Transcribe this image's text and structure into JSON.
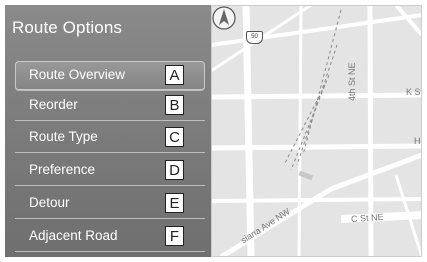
{
  "panel": {
    "title": "Route Options",
    "items": [
      {
        "label": "Route Overview",
        "callout": "A",
        "selected": true
      },
      {
        "label": "Reorder",
        "callout": "B",
        "selected": false
      },
      {
        "label": "Route Type",
        "callout": "C",
        "selected": false
      },
      {
        "label": "Preference",
        "callout": "D",
        "selected": false
      },
      {
        "label": "Detour",
        "callout": "E",
        "selected": false
      },
      {
        "label": "Adjacent Road",
        "callout": "F",
        "selected": false
      }
    ]
  },
  "map": {
    "highway_shield": "50",
    "street_4th": "4th St NE",
    "street_k": "K S",
    "street_h": "H",
    "street_c": "C St NE",
    "street_ave": "siana Ave NW",
    "compass_icon": "north-arrow-icon"
  },
  "colors": {
    "panel_bg": "#7a7a7a",
    "panel_text": "#ffffff",
    "map_bg": "#e4e4e4",
    "road": "#ffffff",
    "callout_border": "#222222"
  }
}
